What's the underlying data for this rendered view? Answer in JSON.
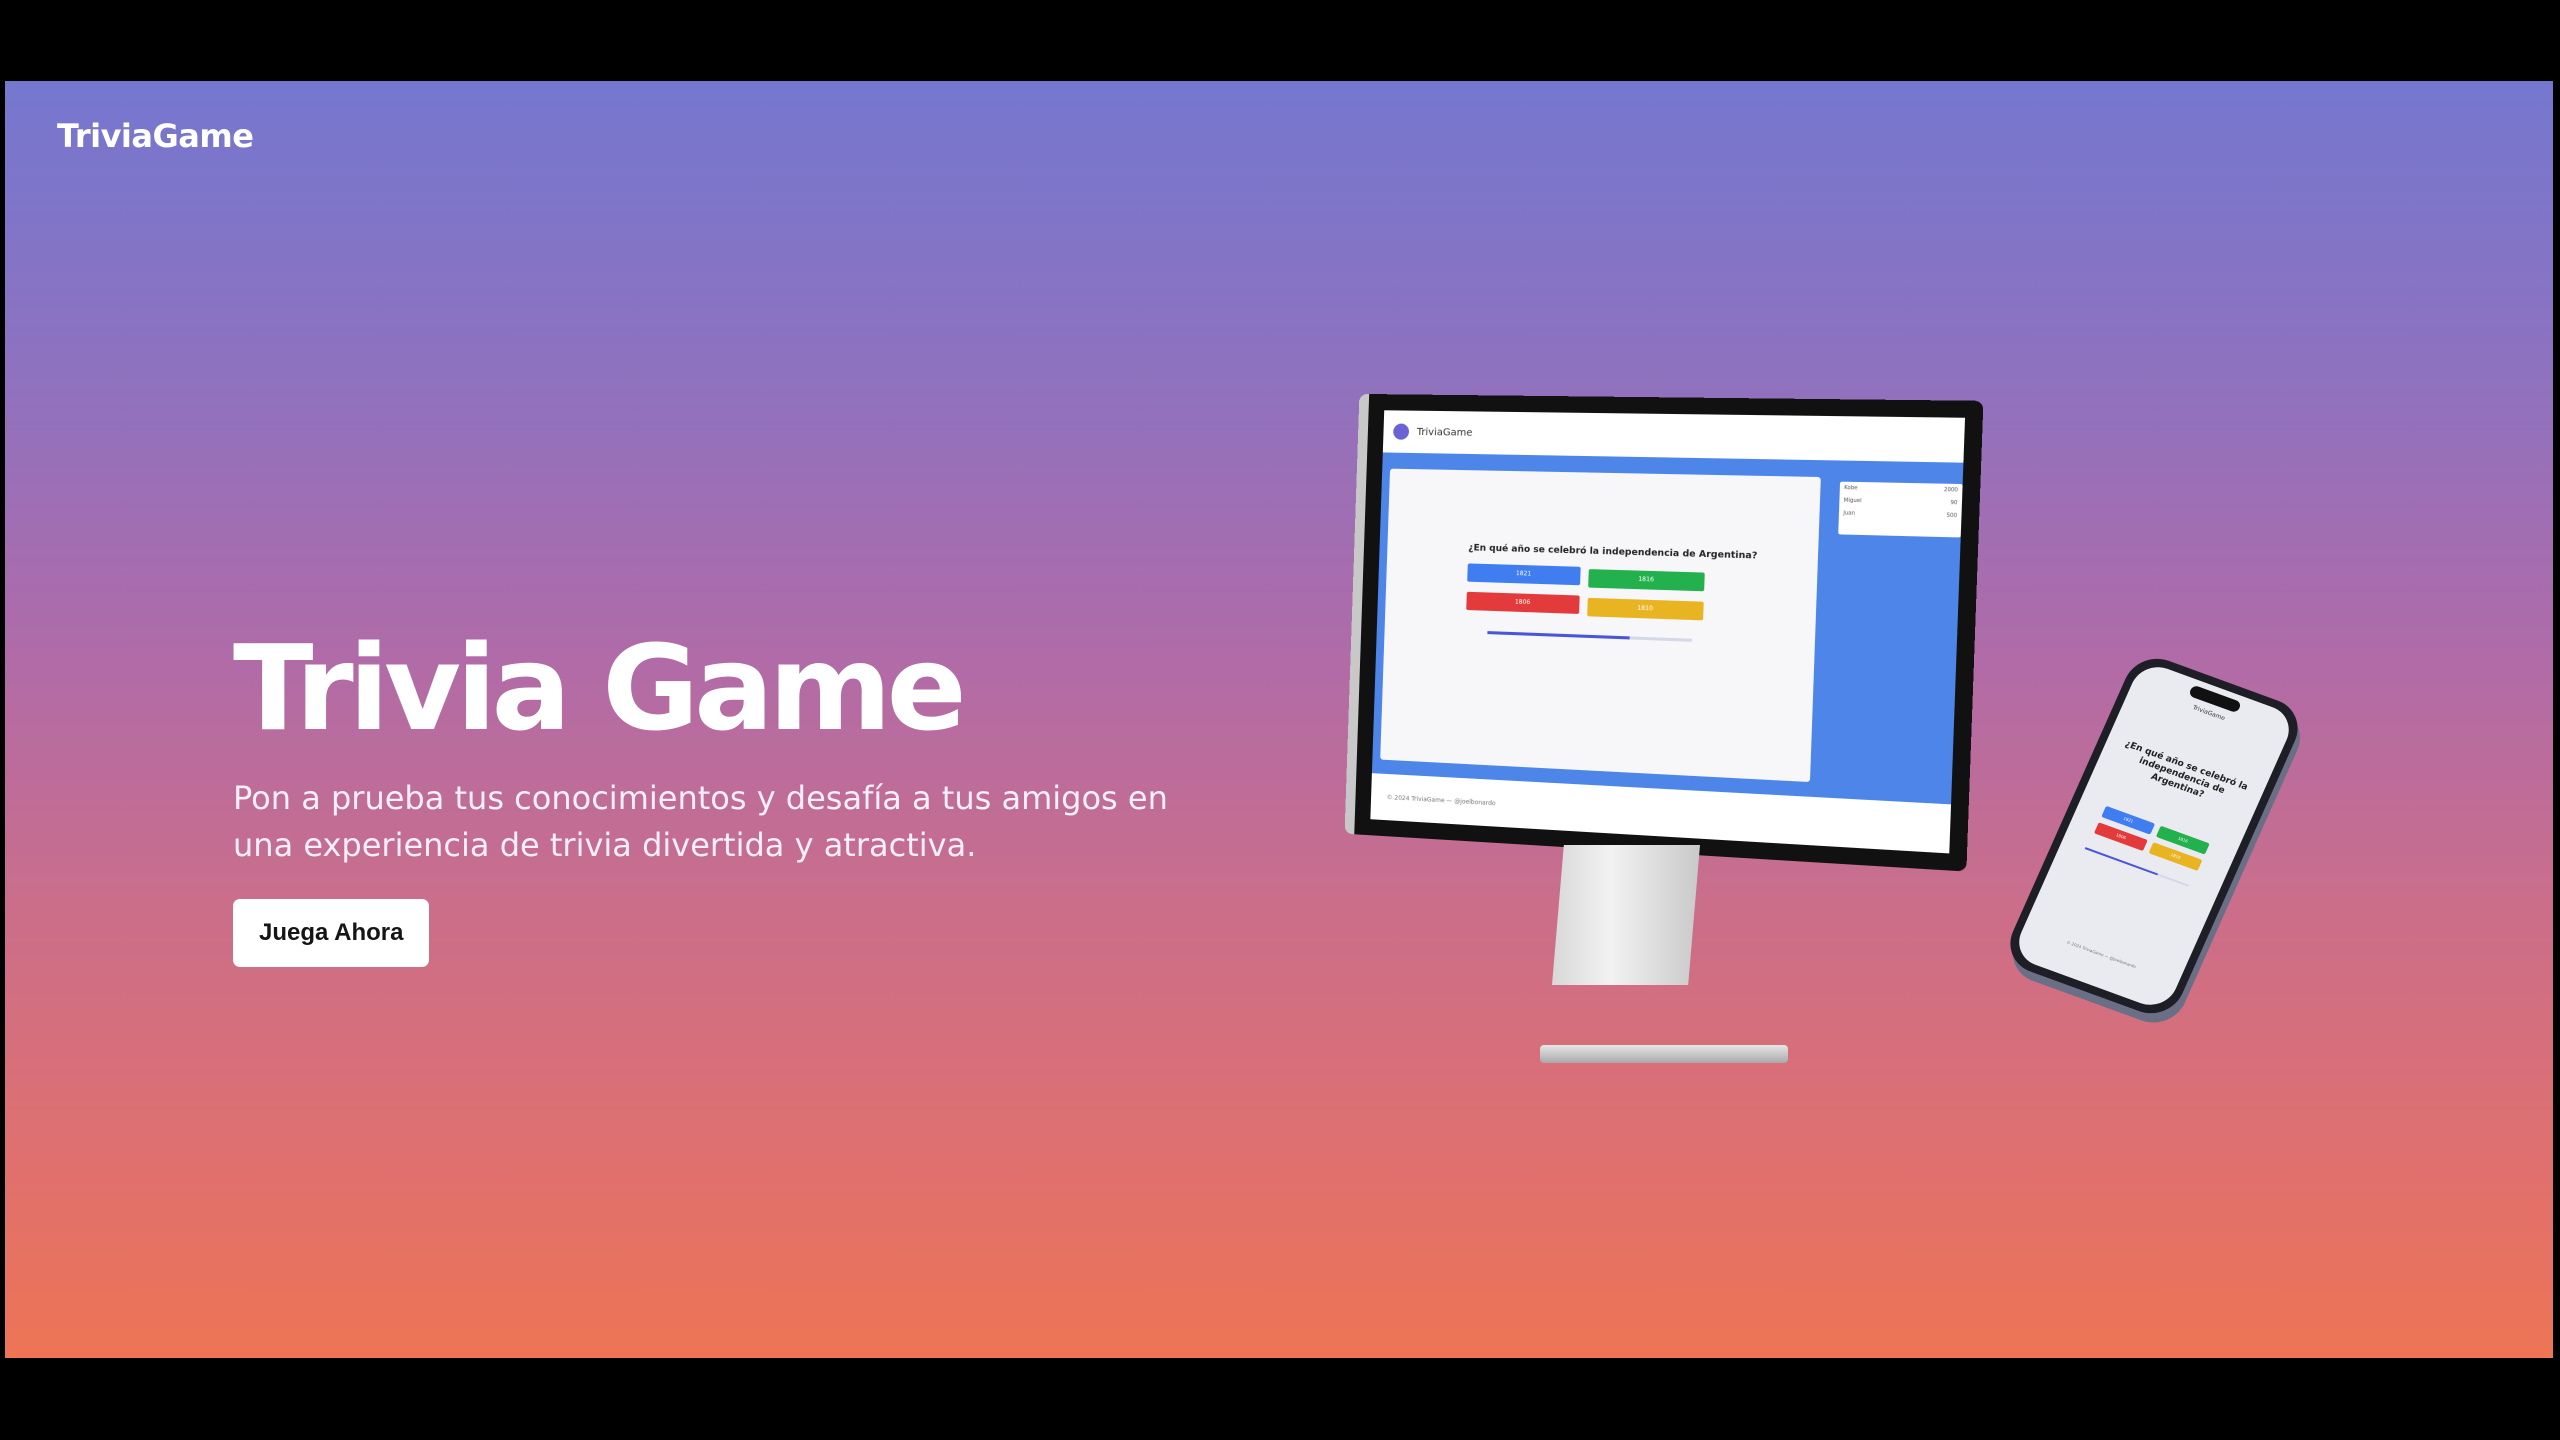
{
  "nav": {
    "brand": "TriviaGame"
  },
  "hero": {
    "title": "Trivia Game",
    "subtitle": "Pon a prueba tus conocimientos y desafía a tus amigos en una experiencia de trivia divertida y atractiva.",
    "cta_label": "Juega Ahora"
  },
  "mockup": {
    "app_title": "TriviaGame",
    "question": "¿En qué año se celebró la independencia de Argentina?",
    "options": [
      "1821",
      "1816",
      "1806",
      "1810"
    ],
    "option_colors": [
      "#3f7df0",
      "#22b14c",
      "#e33b3b",
      "#e8b422"
    ],
    "scoreboard": [
      {
        "name": "Kobe",
        "score": "2000"
      },
      {
        "name": "Miguel",
        "score": "90"
      },
      {
        "name": "Juan",
        "score": "500"
      }
    ],
    "progress": 0.7,
    "footer": "© 2024 TriviaGame — @joelbonardo"
  },
  "colors": {
    "gradient_top": "#7577cf",
    "gradient_bottom": "#ee7454",
    "cta_bg": "#ffffff"
  }
}
